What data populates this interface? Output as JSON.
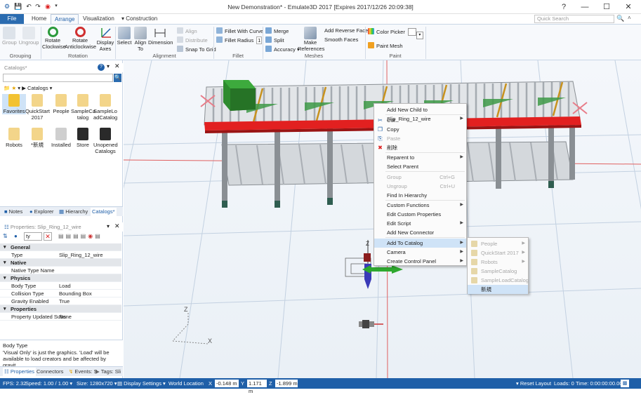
{
  "window": {
    "title": "New Demonstration* - Emulate3D 2017 [Expires 2017/12/26 20:09:38]",
    "quick_access": [
      "save-icon",
      "undo-icon",
      "redo-icon",
      "record-icon",
      "dropdown-icon"
    ],
    "controls": {
      "help": "?",
      "minimize": "—",
      "maximize": "☐",
      "close": "✕"
    }
  },
  "ribbon_tabs": {
    "file": "File",
    "home": "Home",
    "arrange": "Arrange",
    "visualization": "Visualization",
    "construction": "Construction"
  },
  "search": {
    "placeholder": "Quick Search"
  },
  "ribbon": {
    "grouping": {
      "label": "Grouping",
      "group": "Group",
      "ungroup": "Ungroup"
    },
    "rotation": {
      "label": "Rotation",
      "rotate_cw": "Rotate Clockwise",
      "rotate_acw": "Rotate Anticlockwise",
      "display_axes": "Display Axes"
    },
    "alignment": {
      "label": "Alignment",
      "select": "Select",
      "align_to": "Align To",
      "dimension": "Dimension",
      "align": "Align",
      "distribute": "Distribute",
      "snap": "Snap To Grid"
    },
    "fillet": {
      "label": "Fillet",
      "with_curve": "Fillet With Curve",
      "radius": "Fillet Radius",
      "radius_value": "1"
    },
    "meshes": {
      "label": "Meshes",
      "merge": "Merge",
      "split": "Split",
      "accuracy": "Accuracy",
      "make_references": "Make References",
      "add_reverse": "Add Reverse Faces",
      "smooth": "Smooth Faces"
    },
    "paint": {
      "label": "Paint",
      "color_picker": "Color Picker",
      "paint_mesh": "Paint Mesh"
    }
  },
  "catalogs": {
    "title": "Catalogs*",
    "breadcrumb": "Catalogs",
    "items": [
      "Favorites",
      "QuickStart 2017",
      "People",
      "SampleCa talog",
      "SampleLo adCatalog",
      "Robots",
      "*新規",
      "Installed",
      "Store",
      "Unopened Catalogs"
    ]
  },
  "panel_tabs": [
    "Notes",
    "Explorer",
    "Hierarchy",
    "Catalogs*"
  ],
  "properties": {
    "title": "Properties: Slip_Ring_12_wire",
    "filter": "ty",
    "rows": [
      {
        "kind": "cat",
        "k": "General",
        "v": ""
      },
      {
        "kind": "row",
        "k": "Type",
        "v": "Slip_Ring_12_wire"
      },
      {
        "kind": "cat",
        "k": "Native",
        "v": ""
      },
      {
        "kind": "row",
        "k": "Native Type Name",
        "v": ""
      },
      {
        "kind": "cat",
        "k": "Physics",
        "v": ""
      },
      {
        "kind": "row",
        "k": "Body Type",
        "v": "Load"
      },
      {
        "kind": "row",
        "k": "Collision Type",
        "v": "Bounding Box"
      },
      {
        "kind": "row",
        "k": "Gravity Enabled",
        "v": "True"
      },
      {
        "kind": "cat",
        "k": "Properties",
        "v": ""
      },
      {
        "kind": "row",
        "k": "Property Updated Subs",
        "v": "None"
      }
    ],
    "desc_title": "Body Type",
    "desc_text": "'Visual Only' is just the graphics. 'Load' will be available to load creators and be affected by gravit..."
  },
  "bottom_tabs": [
    "Properties",
    "Connectors",
    "Events: S",
    "Tags: Sli"
  ],
  "context_menu": {
    "items": [
      {
        "label": "Add New Child to Slip_Ring_12_wire",
        "sub": true,
        "dis": false,
        "ic": ""
      },
      {
        "label": "Cut",
        "dis": false,
        "ic": "✂"
      },
      {
        "label": "Copy",
        "dis": false,
        "ic": "❐"
      },
      {
        "label": "Paste",
        "dis": true,
        "ic": "⎘"
      },
      {
        "label": "削除",
        "dis": false,
        "ic": "✖"
      },
      {
        "label": "Reparent to",
        "sub": true,
        "dis": false,
        "ic": ""
      },
      {
        "label": "Select Parent",
        "dis": false,
        "ic": ""
      },
      {
        "label": "Group",
        "sc": "Ctrl+G",
        "dis": true,
        "ic": ""
      },
      {
        "label": "Ungroup",
        "sc": "Ctrl+U",
        "dis": true,
        "ic": ""
      },
      {
        "label": "Find In Hierarchy",
        "dis": false,
        "ic": ""
      },
      {
        "label": "Custom Functions",
        "sub": true,
        "dis": false,
        "ic": ""
      },
      {
        "label": "Edit Custom Properties",
        "dis": false,
        "ic": ""
      },
      {
        "label": "Edit Script",
        "sub": true,
        "dis": false,
        "ic": ""
      },
      {
        "label": "Add New Connector",
        "dis": false,
        "ic": ""
      },
      {
        "label": "Add To Catalog",
        "sub": true,
        "dis": false,
        "ic": "",
        "hl": true
      },
      {
        "label": "Camera",
        "sub": true,
        "dis": false,
        "ic": ""
      },
      {
        "label": "Create Control Panel",
        "sub": true,
        "dis": false,
        "ic": ""
      }
    ],
    "submenu": [
      "People",
      "QuickStart 2017",
      "Robots",
      "SampleCatalog",
      "SampleLoadCatalog",
      "新規"
    ]
  },
  "status": {
    "fps": "FPS: 2.32",
    "speed": "Speed: 1.00 / 1.00",
    "size": "Size: 1280x720",
    "display": "Display Settings",
    "world": "World Location",
    "x_lbl": "X",
    "x": "-0.148 m",
    "y_lbl": "Y",
    "y": "1.171 m",
    "z_lbl": "Z",
    "z": "-1.899 m",
    "reset": "Reset Layout",
    "loads": "Loads: 0",
    "time": "Time: 0:00:00:00.00"
  },
  "colors": {
    "accent": "#1f5fa8",
    "conveyor_red": "#e22020",
    "frame": "#8a8f94",
    "roller": "#b7bcc2",
    "load_green": "#2e8b2e"
  }
}
